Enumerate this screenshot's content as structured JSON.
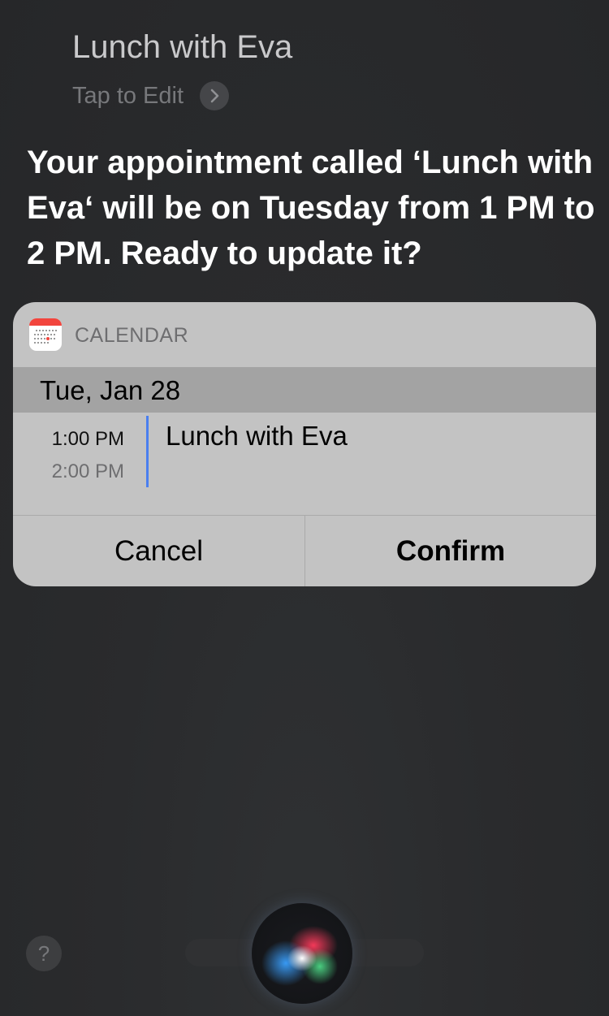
{
  "siri": {
    "query": "Lunch with Eva",
    "tap_to_edit": "Tap to Edit",
    "response": "Your appointment called ‘Lunch with Eva‘ will be on Tuesday from 1 PM to 2 PM. Ready to update it?"
  },
  "card": {
    "app_name": "CALENDAR",
    "date": "Tue, Jan 28",
    "event": {
      "start_time": "1:00 PM",
      "end_time": "2:00 PM",
      "title": "Lunch with Eva",
      "color": "#4a7ff0"
    },
    "cancel_label": "Cancel",
    "confirm_label": "Confirm"
  },
  "bottom": {
    "help_label": "?"
  },
  "icons": {
    "calendar_app": "calendar-app-icon",
    "chevron": "chevron-right-icon",
    "siri": "siri-orb-icon"
  },
  "colors": {
    "background": "#2a2b2d",
    "card": "#c3c3c3",
    "date_row": "#a3a3a3",
    "calendar_red": "#f2453d"
  }
}
